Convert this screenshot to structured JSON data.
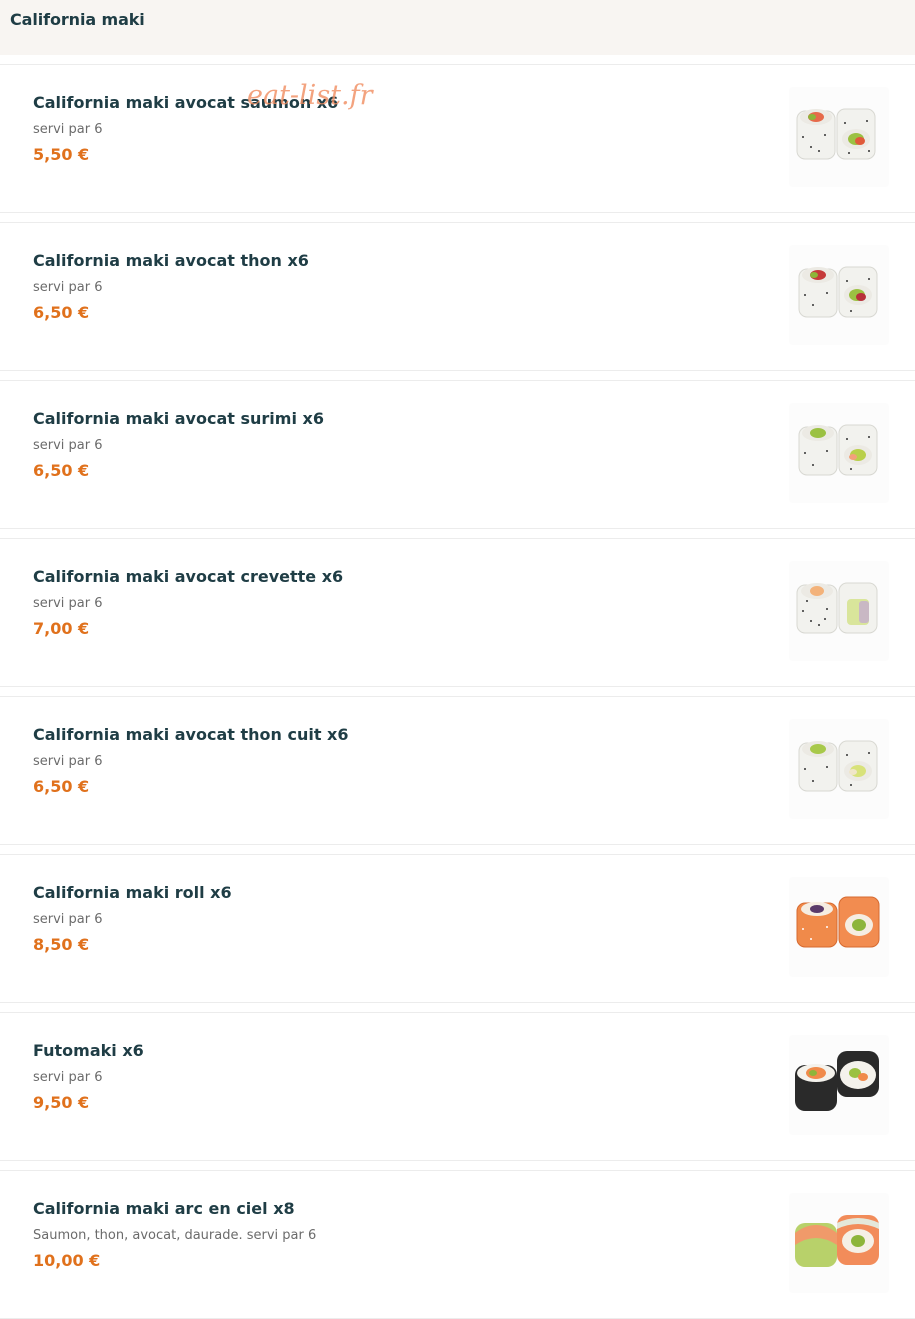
{
  "section": {
    "title": "California maki"
  },
  "watermark": "eat-list.fr",
  "colors": {
    "accent_price": "#e0711c",
    "text_dark": "#1f3d45",
    "header_bg": "#f8f5f2"
  },
  "items": [
    {
      "name": "California maki avocat saumon x6",
      "desc": "servi par 6",
      "price": "5,50 €",
      "image": "sushi-salmon-avocado"
    },
    {
      "name": "California maki avocat thon x6",
      "desc": "servi par 6",
      "price": "6,50 €",
      "image": "sushi-tuna-avocado"
    },
    {
      "name": "California maki avocat surimi x6",
      "desc": "servi par 6",
      "price": "6,50 €",
      "image": "sushi-surimi-avocado"
    },
    {
      "name": "California maki avocat crevette x6",
      "desc": "servi par 6",
      "price": "7,00 €",
      "image": "sushi-shrimp-avocado"
    },
    {
      "name": "California maki avocat thon cuit x6",
      "desc": "servi par 6",
      "price": "6,50 €",
      "image": "sushi-cooked-tuna-avocado"
    },
    {
      "name": "California maki roll x6",
      "desc": "servi par 6",
      "price": "8,50 €",
      "image": "sushi-roll"
    },
    {
      "name": "Futomaki x6",
      "desc": "servi par 6",
      "price": "9,50 €",
      "image": "sushi-futomaki"
    },
    {
      "name": "California maki arc en ciel x8",
      "desc": "Saumon, thon, avocat, daurade. servi par 6",
      "price": "10,00 €",
      "image": "sushi-rainbow"
    }
  ]
}
